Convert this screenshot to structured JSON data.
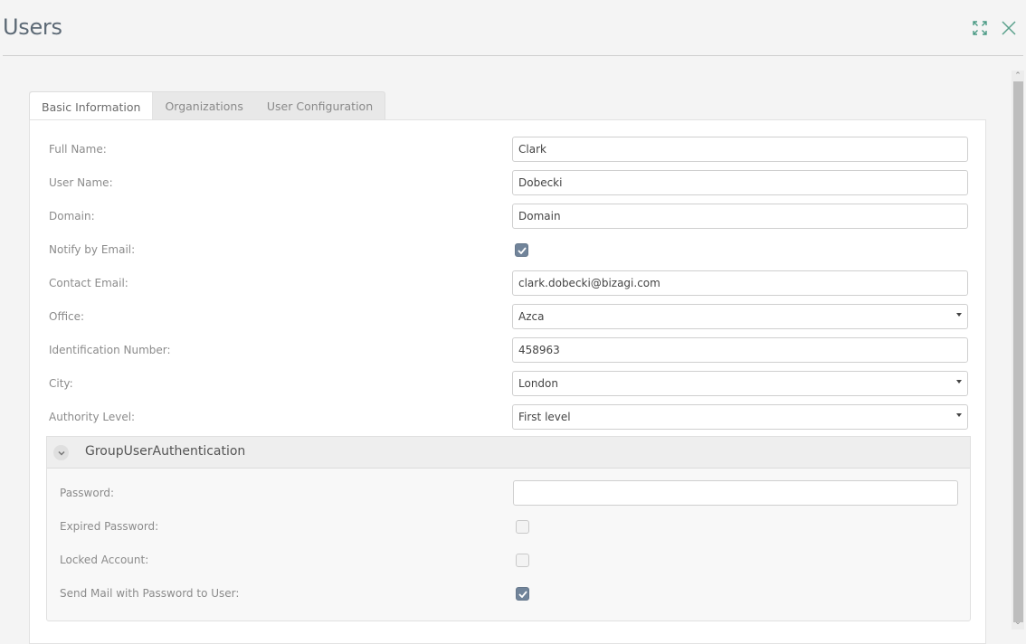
{
  "header": {
    "title": "Users",
    "maximize_icon": "expand-arrows-icon",
    "close_icon": "close-x-icon"
  },
  "tabs": [
    {
      "label": "Basic Information",
      "active": true
    },
    {
      "label": "Organizations",
      "active": false
    },
    {
      "label": "User Configuration",
      "active": false
    }
  ],
  "form": {
    "full_name": {
      "label": "Full Name:",
      "value": "Clark"
    },
    "user_name": {
      "label": "User Name:",
      "value": "Dobecki"
    },
    "domain": {
      "label": "Domain:",
      "value": "Domain"
    },
    "notify_by_email": {
      "label": "Notify by Email:",
      "checked": true
    },
    "contact_email": {
      "label": "Contact Email:",
      "value": "clark.dobecki@bizagi.com"
    },
    "office": {
      "label": "Office:",
      "value": "Azca"
    },
    "identification_number": {
      "label": "Identification Number:",
      "value": "458963"
    },
    "city": {
      "label": "City:",
      "value": "London"
    },
    "authority_level": {
      "label": "Authority Level:",
      "value": "First level"
    }
  },
  "group": {
    "title": "GroupUserAuthentication",
    "expanded": true,
    "password": {
      "label": "Password:",
      "value": ""
    },
    "expired_password": {
      "label": "Expired Password:",
      "checked": false
    },
    "locked_account": {
      "label": "Locked Account:",
      "checked": false
    },
    "send_mail": {
      "label": "Send Mail with Password to User:",
      "checked": true
    }
  },
  "colors": {
    "accent_icon": "#4a9a84",
    "checkbox_checked": "#71849a",
    "title": "#5d6a76"
  }
}
